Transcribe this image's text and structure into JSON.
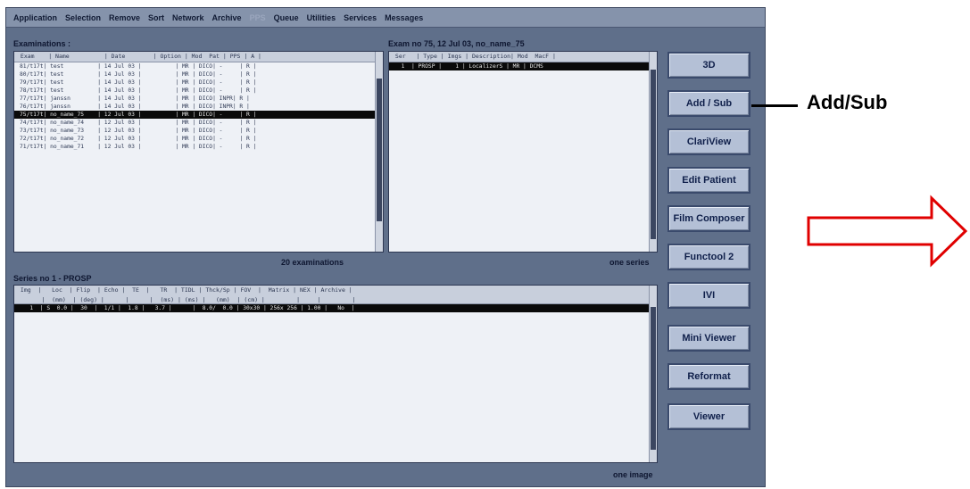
{
  "menu": [
    "Application",
    "Selection",
    "Remove",
    "Sort",
    "Network",
    "Archive",
    "PPS",
    "Queue",
    "Utilities",
    "Services",
    "Messages"
  ],
  "menu_disabled": "PPS",
  "exams": {
    "title": "Examinations :",
    "header": " Exam    | Name          | Date        | Option | Mod  Pat | PPS | A |",
    "rows": [
      "81/t17t| test          | 14 Jul 03 |          | MR | DICO| -     | R |",
      "80/t17t| test          | 14 Jul 03 |          | MR | DICO| -     | R |",
      "79/t17t| test          | 14 Jul 03 |          | MR | DICO| -     | R |",
      "78/t17t| test          | 14 Jul 03 |          | MR | DICO| -     | R |",
      "77/t17t| janssn        | 14 Jul 03 |          | MR | DICO| INPR| R |",
      "76/t17t| janssn        | 14 Jul 03 |          | MR | DICO| INPR| R |",
      "75/t17t| no_name_75    | 12 Jul 03 |          | MR | DICO| -     | R |",
      "74/t17t| no_name_74    | 12 Jul 03 |          | MR | DICO| -     | R |",
      "73/t17t| no_name_73    | 12 Jul 03 |          | MR | DICO| -     | R |",
      "72/t17t| no_name_72    | 12 Jul 03 |          | MR | DICO| -     | R |",
      "71/t17t| no_name_71    | 12 Jul 03 |          | MR | DICO| -     | R |"
    ],
    "selected_index": 6,
    "count": "20 examinations"
  },
  "exam_detail": {
    "title": "Exam no 75,  12 Jul 03, no_name_75",
    "header": " Ser   | Type | Imgs | Description| Mod  MacF |",
    "rows": [
      "  1  | PROSP |    1 | LocalizerS | MR | DCMS"
    ],
    "count": "one series"
  },
  "series": {
    "title": "Series no 1 - PROSP",
    "header": " Img  |   Loc  | Flip  | Echo |  TE  |   TR  | TIDL | Thck/Sp | FOV  |  Matrix | NEX | Archive |\n       |  (mm)  | (deg) |      |      |  (ms) | (ms) |   (mm)  | (cm) |         |     |         |",
    "rows": [
      "   1  | S  0.0 |  30  |  1/1 |  1.8 |   3.7 |      |  8.0/  0.0 | 30x30 | 256x 256 | 1.00 |   No  |"
    ],
    "count": "one image"
  },
  "buttons": [
    "3D",
    "Add / Sub",
    "ClariView",
    "Edit Patient",
    "Film Composer",
    "Functool 2",
    "IVI",
    "Mini Viewer",
    "Reformat",
    "Viewer"
  ],
  "annotation": {
    "label": "Add/Sub",
    "arrow_color": "#e00000"
  }
}
